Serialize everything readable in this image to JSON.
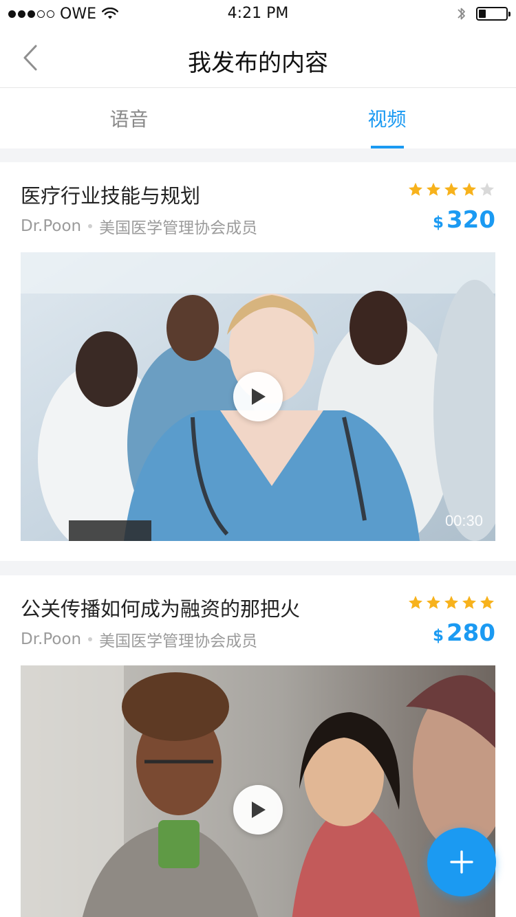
{
  "status_bar": {
    "carrier": "OWE",
    "time": "4:21 PM",
    "signal_bars": 3,
    "signal_total": 5,
    "battery_level": 0.25
  },
  "nav": {
    "title": "我发布的内容",
    "back_icon": "chevron-left-icon"
  },
  "tabs": [
    {
      "label": "语音",
      "active": false
    },
    {
      "label": "视频",
      "active": true
    }
  ],
  "posts": [
    {
      "title": "医疗行业技能与规划",
      "author": "Dr.Poon",
      "affiliation": "美国医学管理协会成员",
      "rating": 4,
      "rating_max": 5,
      "currency": "$",
      "price": "320",
      "duration": "00:30"
    },
    {
      "title": "公关传播如何成为融资的那把火",
      "author": "Dr.Poon",
      "affiliation": "美国医学管理协会成员",
      "rating": 5,
      "rating_max": 5,
      "currency": "$",
      "price": "280",
      "duration": ""
    }
  ],
  "fab": {
    "icon": "plus-icon"
  },
  "colors": {
    "accent": "#1b9af2",
    "star_on": "#f7b21c",
    "star_off": "#d9d9d9"
  }
}
